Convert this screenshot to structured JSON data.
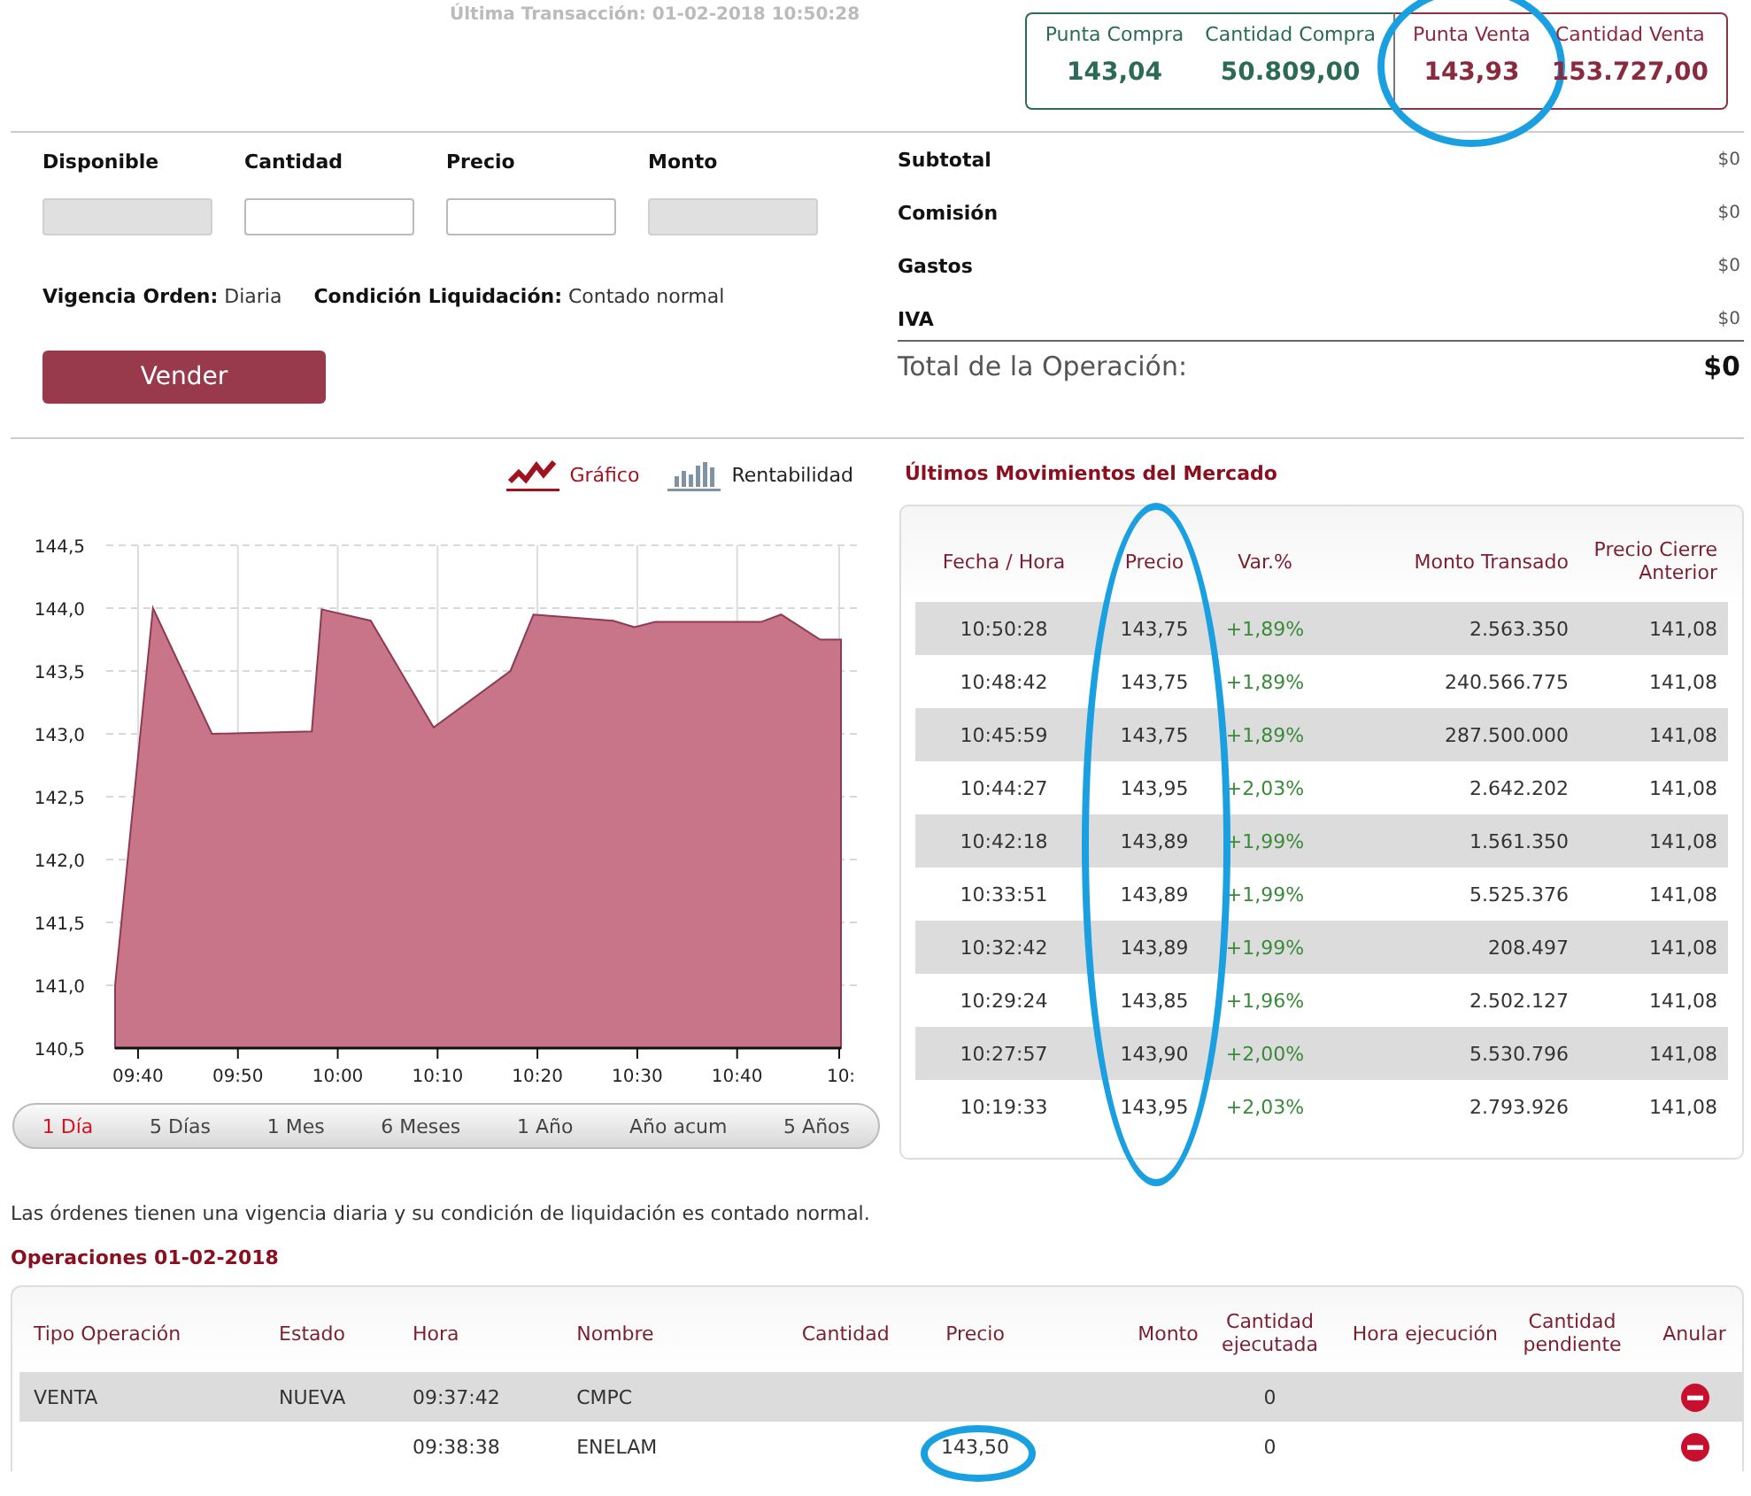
{
  "last_transaction": "Última Transacción: 01-02-2018 10:50:28",
  "bid": [
    {
      "label": "Punta Compra",
      "value": "143,04",
      "circled": false
    },
    {
      "label": "Cantidad Compra",
      "value": "50.809,00",
      "circled": false
    }
  ],
  "ask": [
    {
      "label": "Punta Venta",
      "value": "143,93",
      "circled": true
    },
    {
      "label": "Cantidad Venta",
      "value": "153.727,00",
      "circled": false
    }
  ],
  "order_form": {
    "fields": [
      {
        "label": "Disponible",
        "disabled": true
      },
      {
        "label": "Cantidad",
        "disabled": false
      },
      {
        "label": "Precio",
        "disabled": false
      },
      {
        "label": "Monto",
        "disabled": true
      }
    ],
    "info": [
      {
        "label": "Vigencia Orden:",
        "value": "Diaria"
      },
      {
        "label": "Condición Liquidación:",
        "value": "Contado normal"
      }
    ],
    "submit": "Vender"
  },
  "summary": {
    "rows": [
      {
        "label": "Subtotal",
        "value": "$0"
      },
      {
        "label": "Comisión",
        "value": "$0"
      },
      {
        "label": "Gastos",
        "value": "$0"
      },
      {
        "label": "IVA",
        "value": "$0"
      }
    ],
    "total": {
      "label": "Total de la Operación:",
      "value": "$0"
    }
  },
  "chart_panel": {
    "views": [
      {
        "label": "Gráfico",
        "kind": "line",
        "selected": true
      },
      {
        "label": "Rentabilidad",
        "kind": "bars",
        "selected": false
      }
    ],
    "chart_data": {
      "type": "area",
      "x": [
        577.7,
        581.5,
        587.4,
        597.4,
        598.4,
        603.3,
        609.6,
        617.3,
        619.6,
        627.6,
        629.7,
        631.8,
        642.4,
        644.4,
        648.3,
        650.4
      ],
      "series": [
        {
          "color": "#c8758a",
          "values": [
            141.0,
            144.0,
            143.0,
            143.02,
            143.99,
            143.9,
            143.05,
            143.5,
            143.95,
            143.9,
            143.85,
            143.89,
            143.89,
            143.95,
            143.75,
            143.75
          ]
        }
      ],
      "grid": true,
      "xlim": [
        577.7,
        650.4
      ],
      "ylim": [
        140.5,
        144.5
      ],
      "xticks": [
        {
          "value": 580,
          "label": "09:40"
        },
        {
          "value": 590,
          "label": "09:50"
        },
        {
          "value": 600,
          "label": "10:00"
        },
        {
          "value": 610,
          "label": "10:10"
        },
        {
          "value": 620,
          "label": "10:20"
        },
        {
          "value": 630,
          "label": "10:30"
        },
        {
          "value": 640,
          "label": "10:40"
        }
      ],
      "yticks": [
        {
          "value": 140.5,
          "label": "140,5"
        },
        {
          "value": 141,
          "label": "141,0"
        },
        {
          "value": 141.5,
          "label": "141,5"
        },
        {
          "value": 142,
          "label": "142,0"
        },
        {
          "value": 142.5,
          "label": "142,5"
        },
        {
          "value": 143,
          "label": "143,0"
        },
        {
          "value": 143.5,
          "label": "143,5"
        },
        {
          "value": 144,
          "label": "144,0"
        },
        {
          "value": 144.5,
          "label": "144,5"
        }
      ]
    },
    "axis_cut_label": "10:",
    "ranges": [
      {
        "label": "1 Día",
        "selected": true
      },
      {
        "label": "5 Días",
        "selected": false
      },
      {
        "label": "1 Mes",
        "selected": false
      },
      {
        "label": "6 Meses",
        "selected": false
      },
      {
        "label": "1 Año",
        "selected": false
      },
      {
        "label": "Año acum",
        "selected": false
      },
      {
        "label": "5 Años",
        "selected": false
      }
    ]
  },
  "market": {
    "title": "Últimos Movimientos del Mercado",
    "columns": [
      {
        "label": "Fecha / Hora",
        "circled": false
      },
      {
        "label": "Precio",
        "circled": true
      },
      {
        "label": "Var.%",
        "circled": false
      },
      {
        "label": "Monto Transado",
        "circled": false
      },
      {
        "label": "Precio Cierre Anterior",
        "circled": false
      }
    ],
    "rows": [
      [
        "10:50:28",
        "143,75",
        "+1,89%",
        "2.563.350",
        "141,08"
      ],
      [
        "10:48:42",
        "143,75",
        "+1,89%",
        "240.566.775",
        "141,08"
      ],
      [
        "10:45:59",
        "143,75",
        "+1,89%",
        "287.500.000",
        "141,08"
      ],
      [
        "10:44:27",
        "143,95",
        "+2,03%",
        "2.642.202",
        "141,08"
      ],
      [
        "10:42:18",
        "143,89",
        "+1,99%",
        "1.561.350",
        "141,08"
      ],
      [
        "10:33:51",
        "143,89",
        "+1,99%",
        "5.525.376",
        "141,08"
      ],
      [
        "10:32:42",
        "143,89",
        "+1,99%",
        "208.497",
        "141,08"
      ],
      [
        "10:29:24",
        "143,85",
        "+1,96%",
        "2.502.127",
        "141,08"
      ],
      [
        "10:27:57",
        "143,90",
        "+2,00%",
        "5.530.796",
        "141,08"
      ],
      [
        "10:19:33",
        "143,95",
        "+2,03%",
        "2.793.926",
        "141,08"
      ]
    ]
  },
  "note": "Las órdenes tienen una vigencia diaria y su condición de liquidación es contado normal.",
  "operations": {
    "title": "Operaciones 01-02-2018",
    "columns": [
      "Tipo Operación",
      "Estado",
      "Hora",
      "Nombre",
      "Cantidad",
      "Precio",
      "Monto",
      "Cantidad ejecutada",
      "Hora ejecución",
      "Cantidad pendiente",
      "Anular"
    ],
    "rows": [
      {
        "tipo": "VENTA",
        "estado": "NUEVA",
        "hora": "09:37:42",
        "nombre": "CMPC",
        "cantidad_ejecutada": "0",
        "price_circled": false
      },
      {
        "hora": "09:38:38",
        "nombre": "ENELAM",
        "precio": "143,50",
        "cantidad_ejecutada": "0",
        "price_circled": true
      }
    ]
  }
}
